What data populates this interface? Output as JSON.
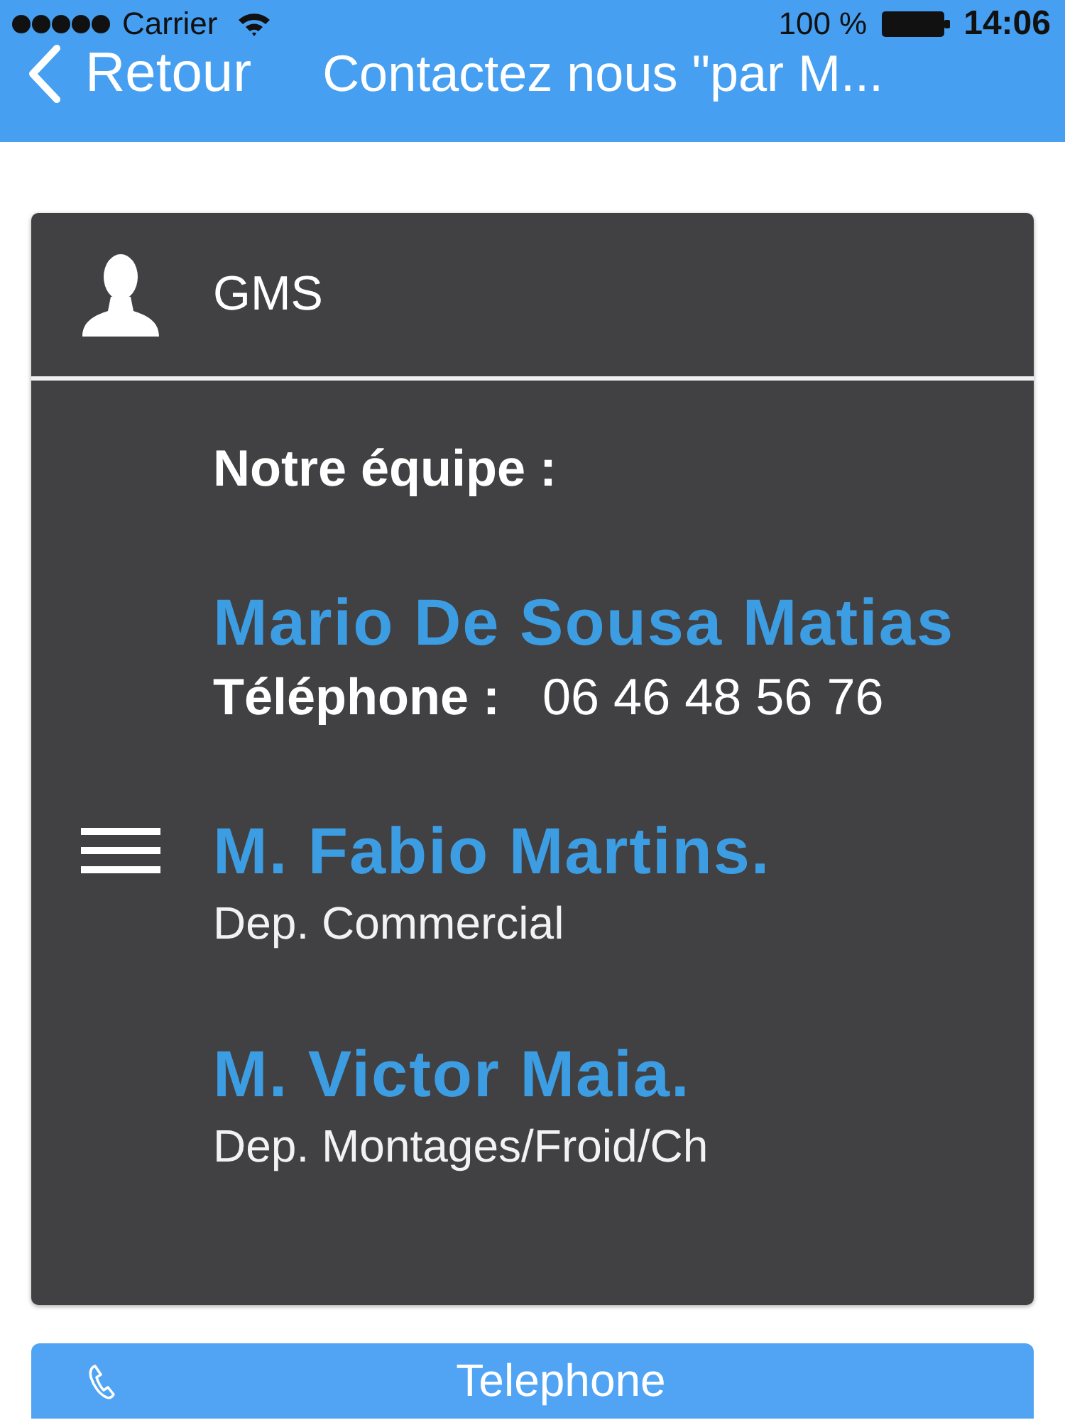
{
  "status_bar": {
    "carrier": "Carrier",
    "battery": "100 %",
    "time": "14:06"
  },
  "nav_bar": {
    "back_label": "Retour",
    "title": "Contactez nous \"par M..."
  },
  "card": {
    "header_title": "GMS",
    "section_title": "Notre équipe :",
    "contacts": [
      {
        "kind": "phone",
        "name": "Mario De Sousa Matias",
        "phone_label": "Téléphone :",
        "phone": "06 46 48 56 76"
      },
      {
        "kind": "department",
        "name": "M. Fabio Martins.",
        "department": "Dep. Commercial"
      },
      {
        "kind": "department",
        "name": "M. Victor Maia.",
        "department": "Dep. Montages/Froid/Ch"
      }
    ]
  },
  "bottom_button": {
    "label": "Telephone"
  }
}
